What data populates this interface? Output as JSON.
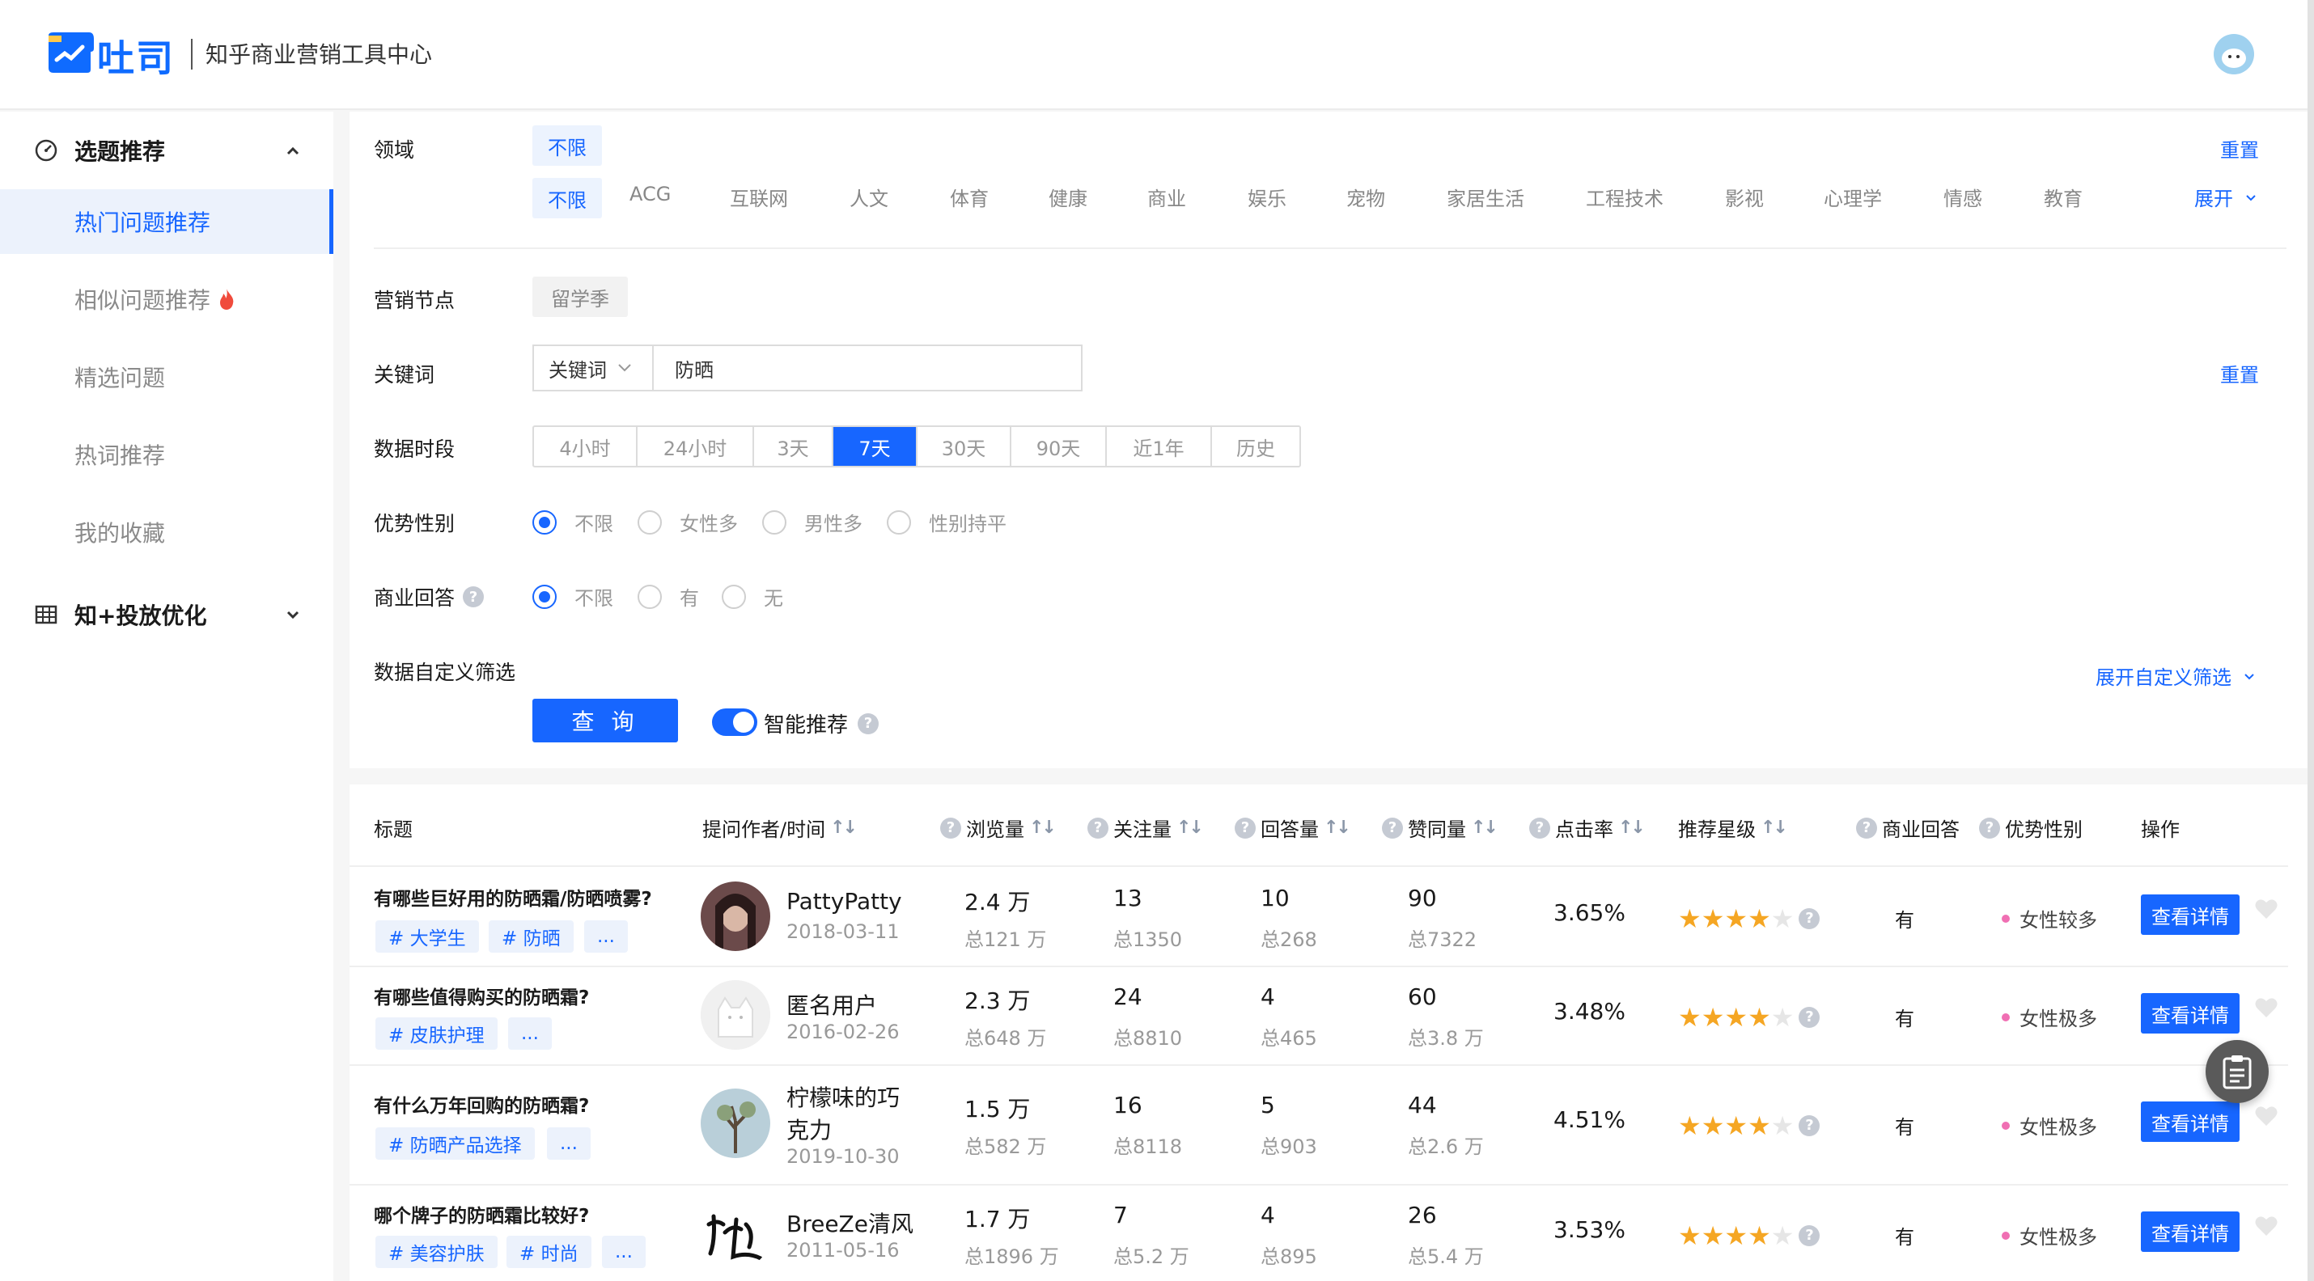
{
  "brand": {
    "logo_text": "吐司",
    "subtitle": "知乎商业营销工具中心"
  },
  "sidebar": {
    "groups": [
      {
        "label": "选题推荐",
        "icon": "gauge-icon",
        "expanded": true
      },
      {
        "label": "知+投放优化",
        "icon": "grid-icon",
        "expanded": false
      }
    ],
    "items": [
      {
        "label": "热门问题推荐",
        "active": true
      },
      {
        "label": "相似问题推荐",
        "badge": "fire-icon"
      },
      {
        "label": "精选问题"
      },
      {
        "label": "热词推荐"
      },
      {
        "label": "我的收藏"
      }
    ]
  },
  "filters": {
    "domain": {
      "label": "领域",
      "selected_chip": "不限",
      "reset": "重置",
      "expand": "展开",
      "categories": [
        "不限",
        "ACG",
        "互联网",
        "人文",
        "体育",
        "健康",
        "商业",
        "娱乐",
        "宠物",
        "家居生活",
        "工程技术",
        "影视",
        "心理学",
        "情感",
        "教育"
      ]
    },
    "marketing": {
      "label": "营销节点",
      "chip": "留学季"
    },
    "keyword": {
      "label": "关键词",
      "select_value": "关键词",
      "input_value": "防晒",
      "reset": "重置"
    },
    "period": {
      "label": "数据时段",
      "options": [
        "4小时",
        "24小时",
        "3天",
        "7天",
        "30天",
        "90天",
        "近1年",
        "历史"
      ],
      "selected": "7天"
    },
    "gender": {
      "label": "优势性别",
      "options": [
        "不限",
        "女性多",
        "男性多",
        "性别持平"
      ],
      "selected": "不限"
    },
    "commercial": {
      "label": "商业回答",
      "options": [
        "不限",
        "有",
        "无"
      ],
      "selected": "不限"
    },
    "custom": {
      "label": "数据自定义筛选",
      "expand_link": "展开自定义筛选"
    },
    "query_button": "查 询",
    "smart_toggle": {
      "label": "智能推荐",
      "on": true
    }
  },
  "table": {
    "headers": {
      "title": "标题",
      "author": "提问作者/时间",
      "views": "浏览量",
      "follows": "关注量",
      "answers": "回答量",
      "likes": "赞同量",
      "ctr": "点击率",
      "rating": "推荐星级",
      "commercial": "商业回答",
      "gender": "优势性别",
      "action": "操作"
    },
    "rows": [
      {
        "title": "有哪些巨好用的防晒霜/防晒喷雾?",
        "tags": [
          "# 大学生",
          "# 防晒",
          "..."
        ],
        "author": "PattyPatty",
        "date": "2018-03-11",
        "views": "2.4 万",
        "views_total": "总121 万",
        "follows": "13",
        "follows_total": "总1350",
        "answers": "10",
        "answers_total": "总268",
        "likes": "90",
        "likes_total": "总7322",
        "ctr": "3.65%",
        "stars": 4,
        "commercial": "有",
        "gender": "女性较多",
        "action": "查看详情"
      },
      {
        "title": "有哪些值得购买的防晒霜?",
        "tags": [
          "# 皮肤护理",
          "..."
        ],
        "author": "匿名用户",
        "date": "2016-02-26",
        "views": "2.3 万",
        "views_total": "总648 万",
        "follows": "24",
        "follows_total": "总8810",
        "answers": "4",
        "answers_total": "总465",
        "likes": "60",
        "likes_total": "总3.8 万",
        "ctr": "3.48%",
        "stars": 4,
        "commercial": "有",
        "gender": "女性极多",
        "action": "查看详情"
      },
      {
        "title": "有什么万年回购的防晒霜?",
        "tags": [
          "# 防晒产品选择",
          "..."
        ],
        "author_line1": "柠檬味的巧",
        "author_line2": "克力",
        "date": "2019-10-30",
        "views": "1.5 万",
        "views_total": "总582 万",
        "follows": "16",
        "follows_total": "总8118",
        "answers": "5",
        "answers_total": "总903",
        "likes": "44",
        "likes_total": "总2.6 万",
        "ctr": "4.51%",
        "stars": 4,
        "commercial": "有",
        "gender": "女性极多",
        "action": "查看详情"
      },
      {
        "title": "哪个牌子的防晒霜比较好?",
        "tags": [
          "# 美容护肤",
          "# 时尚",
          "..."
        ],
        "author": "BreeZe清风",
        "date": "2011-05-16",
        "views": "1.7 万",
        "views_total": "总1896 万",
        "follows": "7",
        "follows_total": "总5.2 万",
        "answers": "4",
        "answers_total": "总895",
        "likes": "26",
        "likes_total": "总5.4 万",
        "ctr": "3.53%",
        "stars": 4,
        "commercial": "有",
        "gender": "女性极多",
        "action": "查看详情"
      }
    ]
  },
  "colors": {
    "accent": "#1766ff",
    "star": "#f5a623",
    "tag_bg": "#ecf2fc"
  }
}
